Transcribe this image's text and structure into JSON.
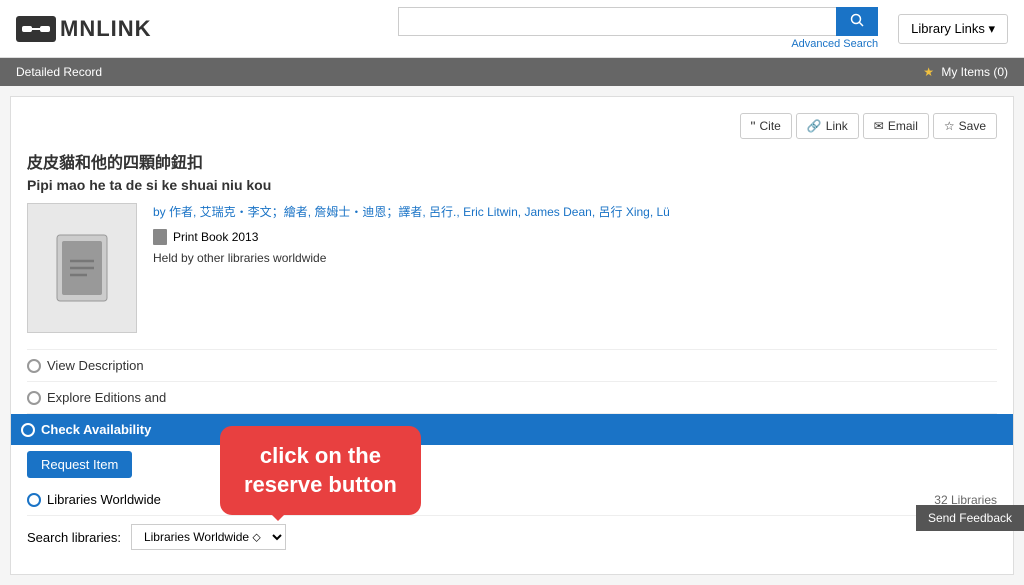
{
  "header": {
    "logo_symbol": "⟵⟶",
    "logo_text": "MNLINK",
    "search_placeholder": "",
    "search_value": "",
    "advanced_search_label": "Advanced Search",
    "library_links_label": "Library Links ▾"
  },
  "navbar": {
    "breadcrumb": "Detailed Record",
    "my_items_label": "My Items (0)"
  },
  "actions": {
    "cite_label": "Cite",
    "link_label": "Link",
    "email_label": "Email",
    "save_label": "Save"
  },
  "record": {
    "title_cn": "皮皮貓和他的四顆帥鈕扣",
    "title_pinyin": "Pipi mao he ta de si ke shuai niu kou",
    "authors_label": "by 作者, 艾瑞克・李文；繪者, 詹姆士・迪恩；譯者, 呂行., Eric Litwin, James Dean, 呂行 Xing, Lü",
    "format_label": "Print Book 2013",
    "held_text": "Held by other libraries worldwide"
  },
  "sections": {
    "view_description": "View Description",
    "explore_editions": "Explore Editions and",
    "check_availability": "Check Availability",
    "request_item": "Request Item",
    "libraries_worldwide": "Libraries Worldwide",
    "libraries_count": "32 Libraries",
    "search_libraries_label": "Search libraries:",
    "libraries_worldwide_option": "Libraries Worldwide ⬦"
  },
  "tooltip": {
    "line1": "click on the",
    "line2": "reserve button"
  },
  "feedback": {
    "label": "Send Feedback"
  }
}
